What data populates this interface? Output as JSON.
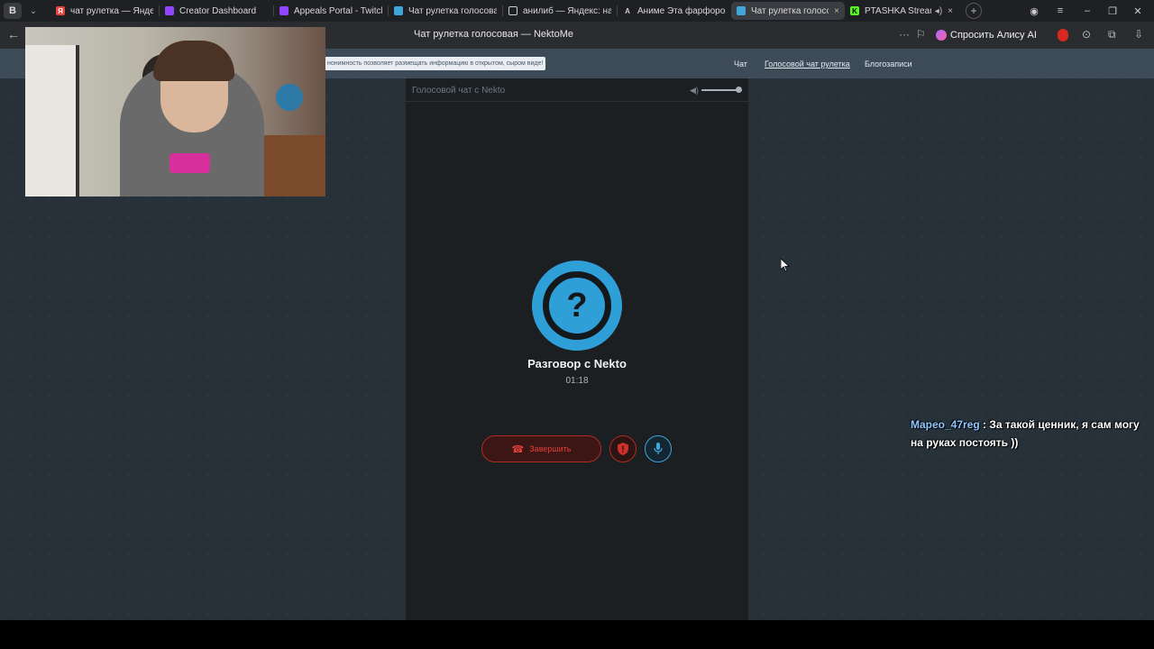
{
  "browser": {
    "ya_button": "B",
    "tabs": [
      {
        "title": "чат рулетка — Яндекс: н",
        "favicon": "yandex-icon",
        "color": "#e8443a"
      },
      {
        "title": "Creator Dashboard",
        "favicon": "twitch-icon",
        "color": "#9146ff"
      },
      {
        "title": "Appeals Portal - Twitch",
        "favicon": "twitch-icon",
        "color": "#9146ff"
      },
      {
        "title": "Чат рулетка голосовая -",
        "favicon": "nekto-icon",
        "color": "#3fa6dc"
      },
      {
        "title": "анилиб — Яндекс: нашл",
        "favicon": "document-icon",
        "color": "#cccccc"
      },
      {
        "title": "Аниме Эта фарфоровая",
        "favicon": "anime-icon",
        "color": "#cccccc"
      },
      {
        "title": "Чат рулетка голосова",
        "favicon": "nekto-icon",
        "color": "#3fa6dc",
        "active": true
      },
      {
        "title": "PTASHKA Stream",
        "favicon": "kick-icon",
        "color": "#53fc18"
      }
    ],
    "close_glyph": "×",
    "new_tab_glyph": "+",
    "page_title": "Чат рулетка голосовая — NektoMe",
    "alice_label": "Спросить Алису AI"
  },
  "site": {
    "notice": "нонимность позволяет размещать информацию в открытом, сыром виде!",
    "nav": [
      "Чат",
      "Голосовой чат рулетка",
      "Блогозаписи"
    ],
    "panel_title": "Голосовой чат с Nekto",
    "volume_level": 0.9,
    "avatar_glyph": "?",
    "partner_label": "Разговор с Nekto",
    "timer": "01:18",
    "end_button": "Завершить"
  },
  "stream_chat": {
    "user": "Mapeo_47reg",
    "separator": " : ",
    "text": "За такой ценник, я сам могу на руках постоять ))"
  },
  "colors": {
    "accent": "#2f9fd8",
    "danger": "#e0413a",
    "header": "#3d4b59",
    "panel": "#1b1f22"
  }
}
